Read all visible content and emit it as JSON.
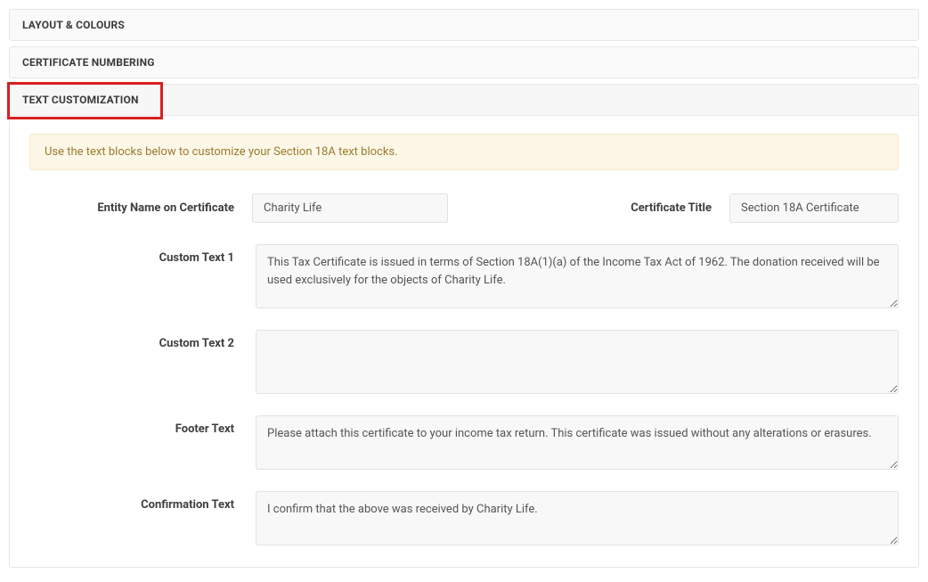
{
  "panels": {
    "layout_colours": "LAYOUT & COLOURS",
    "certificate_numbering": "CERTIFICATE NUMBERING",
    "text_customization": "TEXT CUSTOMIZATION"
  },
  "info_banner": "Use the text blocks below to customize your Section 18A text blocks.",
  "fields": {
    "entity_name": {
      "label": "Entity Name on Certificate",
      "value": "Charity Life"
    },
    "certificate_title": {
      "label": "Certificate Title",
      "value": "Section 18A Certificate"
    },
    "custom_text_1": {
      "label": "Custom Text 1",
      "value": "This Tax Certificate is issued in terms of Section 18A(1)(a) of the Income Tax Act of 1962. The donation received will be used exclusively for the objects of Charity Life."
    },
    "custom_text_2": {
      "label": "Custom Text 2",
      "value": ""
    },
    "footer_text": {
      "label": "Footer Text",
      "value": "Please attach this certificate to your income tax return. This certificate was issued without any alterations or erasures."
    },
    "confirmation_text": {
      "label": "Confirmation Text",
      "value": "I confirm that the above was received by Charity Life."
    }
  }
}
